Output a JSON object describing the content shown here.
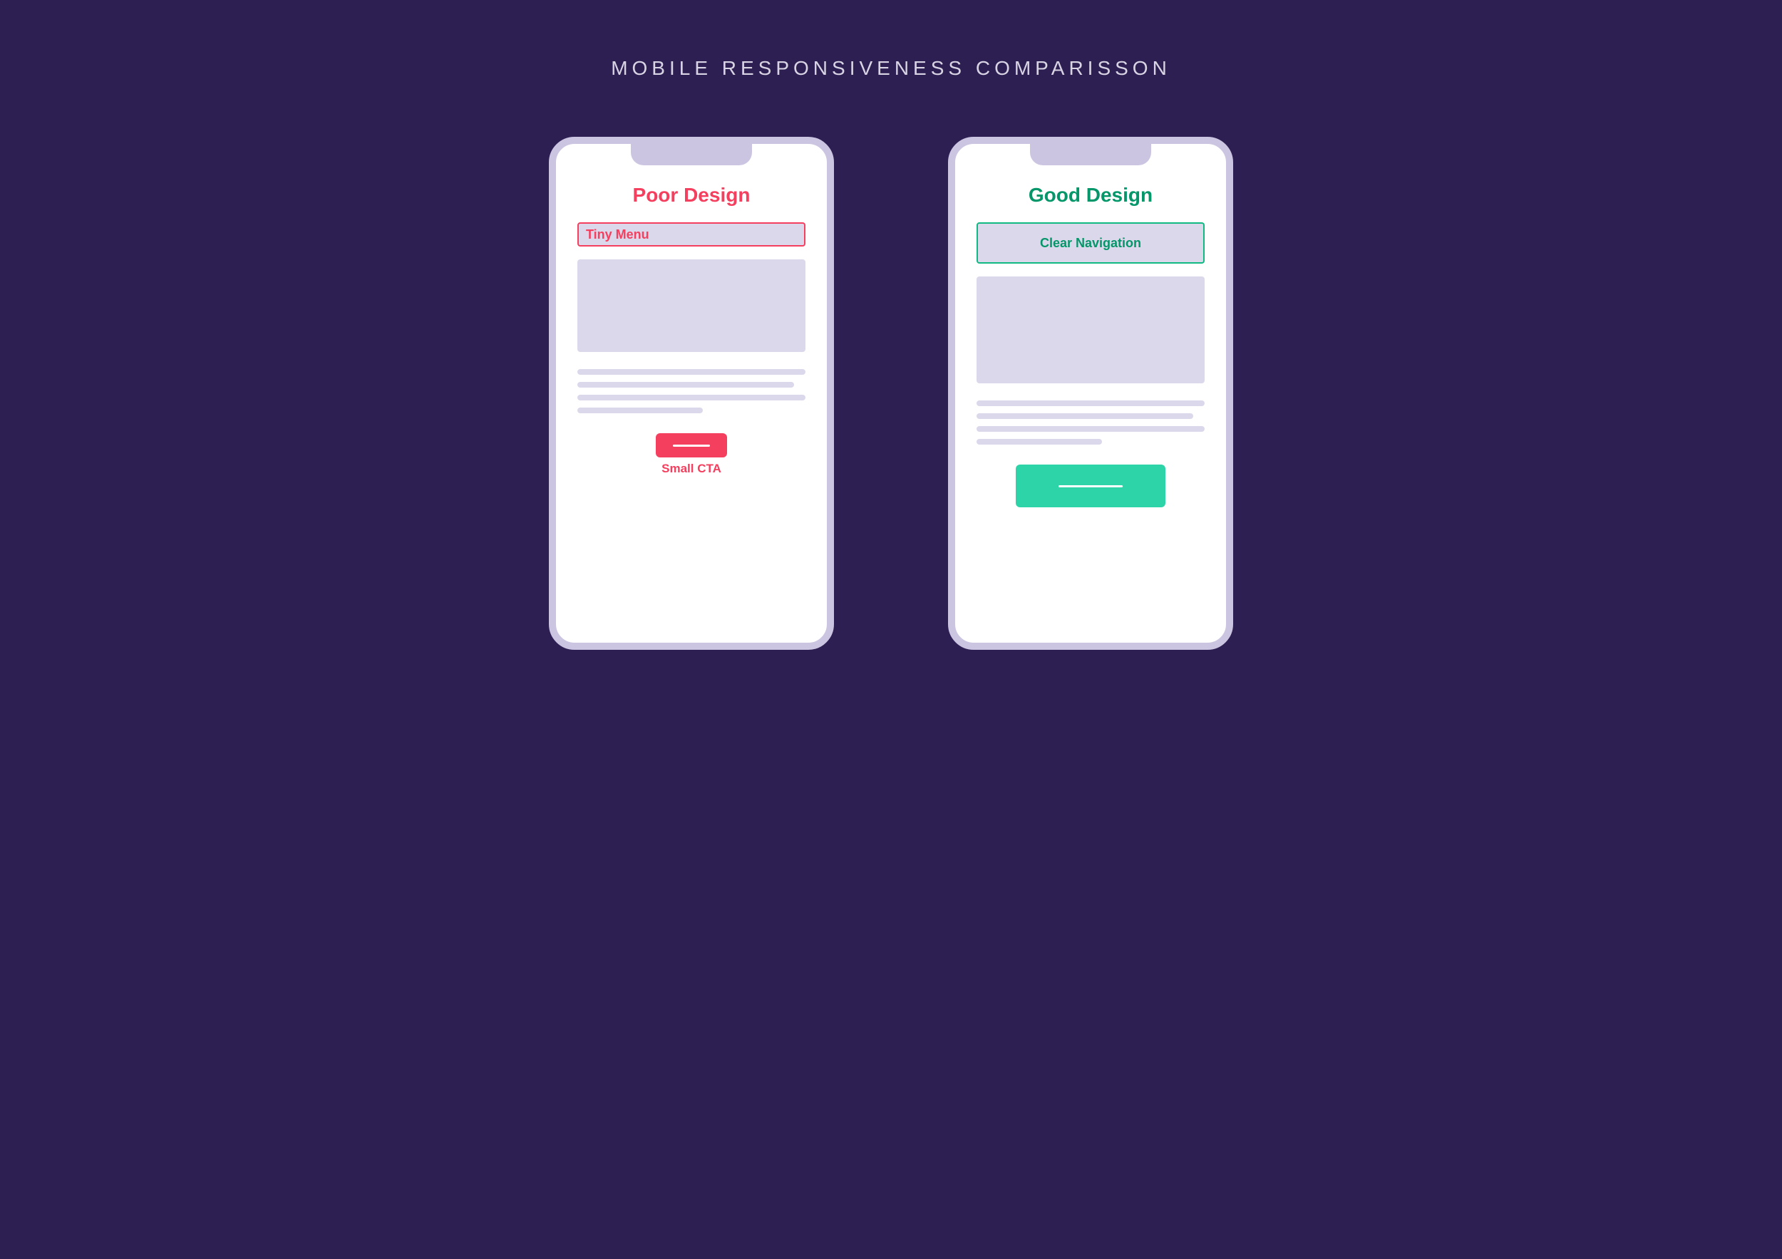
{
  "title": "MOBILE RESPONSIVENESS COMPARISSON",
  "bad": {
    "heading": "Poor Design",
    "nav_label": "Tiny Menu",
    "cta_caption": "Small CTA"
  },
  "good": {
    "heading": "Good Design",
    "nav_label": "Clear Navigation"
  },
  "colors": {
    "background": "#2e1f53",
    "phone_bezel": "#ccc5e2",
    "placeholder": "#dcd8eb",
    "bad_accent": "#f43f5e",
    "good_accent_text": "#059669",
    "good_accent_fill": "#2dd4a7"
  }
}
